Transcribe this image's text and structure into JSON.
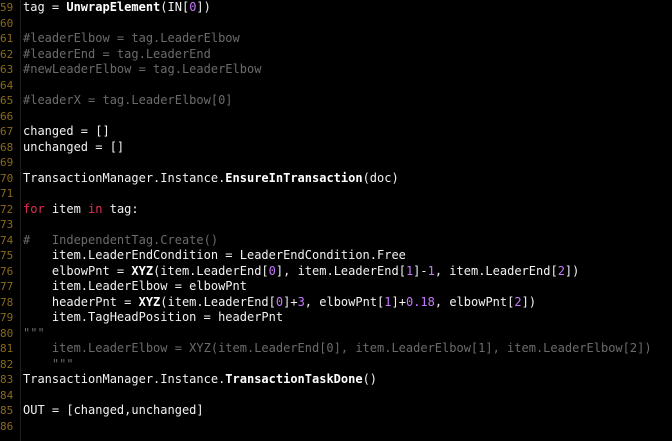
{
  "editor": {
    "colors": {
      "background": "#000000",
      "line_number": "#8a6a1a",
      "keyword": "#e02e55",
      "number": "#c678ff",
      "comment": "#6b6b6b",
      "text": "#f2f2f2"
    },
    "lines": [
      {
        "n": "59",
        "tokens": [
          [
            "plain",
            "tag = "
          ],
          [
            "fn",
            "UnwrapElement"
          ],
          [
            "plain",
            "(IN["
          ],
          [
            "num",
            "0"
          ],
          [
            "plain",
            "])"
          ]
        ]
      },
      {
        "n": "60",
        "tokens": []
      },
      {
        "n": "61",
        "tokens": [
          [
            "cmt",
            "#leaderElbow = tag.LeaderElbow"
          ]
        ]
      },
      {
        "n": "62",
        "tokens": [
          [
            "cmt",
            "#leaderEnd = tag.LeaderEnd"
          ]
        ]
      },
      {
        "n": "63",
        "tokens": [
          [
            "cmt",
            "#newLeaderElbow = tag.LeaderElbow"
          ]
        ]
      },
      {
        "n": "64",
        "tokens": []
      },
      {
        "n": "65",
        "tokens": [
          [
            "cmt",
            "#leaderX = tag.LeaderElbow[0]"
          ]
        ]
      },
      {
        "n": "66",
        "tokens": []
      },
      {
        "n": "67",
        "tokens": [
          [
            "plain",
            "changed = []"
          ]
        ]
      },
      {
        "n": "68",
        "tokens": [
          [
            "plain",
            "unchanged = []"
          ]
        ]
      },
      {
        "n": "69",
        "tokens": []
      },
      {
        "n": "70",
        "tokens": [
          [
            "plain",
            "TransactionManager.Instance."
          ],
          [
            "fn",
            "EnsureInTransaction"
          ],
          [
            "plain",
            "(doc)"
          ]
        ]
      },
      {
        "n": "71",
        "tokens": []
      },
      {
        "n": "72",
        "tokens": [
          [
            "kw",
            "for"
          ],
          [
            "plain",
            " item "
          ],
          [
            "kw",
            "in"
          ],
          [
            "plain",
            " tag:"
          ]
        ]
      },
      {
        "n": "73",
        "tokens": []
      },
      {
        "n": "74",
        "tokens": [
          [
            "cmt",
            "#   IndependentTag.Create()"
          ]
        ]
      },
      {
        "n": "75",
        "tokens": [
          [
            "plain",
            "    item.LeaderEndCondition = LeaderEndCondition.Free"
          ]
        ]
      },
      {
        "n": "76",
        "tokens": [
          [
            "plain",
            "    elbowPnt = "
          ],
          [
            "fn",
            "XYZ"
          ],
          [
            "plain",
            "(item.LeaderEnd["
          ],
          [
            "num",
            "0"
          ],
          [
            "plain",
            "], item.LeaderEnd["
          ],
          [
            "num",
            "1"
          ],
          [
            "plain",
            "]-"
          ],
          [
            "num",
            "1"
          ],
          [
            "plain",
            ", item.LeaderEnd["
          ],
          [
            "num",
            "2"
          ],
          [
            "plain",
            "])"
          ]
        ]
      },
      {
        "n": "77",
        "tokens": [
          [
            "plain",
            "    item.LeaderElbow = elbowPnt"
          ]
        ]
      },
      {
        "n": "78",
        "tokens": [
          [
            "plain",
            "    headerPnt = "
          ],
          [
            "fn",
            "XYZ"
          ],
          [
            "plain",
            "(item.LeaderEnd["
          ],
          [
            "num",
            "0"
          ],
          [
            "plain",
            "]+"
          ],
          [
            "num",
            "3"
          ],
          [
            "plain",
            ", elbowPnt["
          ],
          [
            "num",
            "1"
          ],
          [
            "plain",
            "]+"
          ],
          [
            "num",
            "0.18"
          ],
          [
            "plain",
            ", elbowPnt["
          ],
          [
            "num",
            "2"
          ],
          [
            "plain",
            "])"
          ]
        ]
      },
      {
        "n": "79",
        "tokens": [
          [
            "plain",
            "    item.TagHeadPosition = headerPnt"
          ]
        ]
      },
      {
        "n": "80",
        "tokens": [
          [
            "str",
            "\"\"\""
          ]
        ]
      },
      {
        "n": "81",
        "tokens": [
          [
            "str",
            "    item.LeaderElbow = XYZ(item.LeaderEnd[0], item.LeaderElbow[1], item.LeaderElbow[2])"
          ]
        ]
      },
      {
        "n": "82",
        "tokens": [
          [
            "str",
            "    \"\"\""
          ]
        ]
      },
      {
        "n": "83",
        "tokens": [
          [
            "plain",
            "TransactionManager.Instance."
          ],
          [
            "fn",
            "TransactionTaskDone"
          ],
          [
            "plain",
            "()"
          ]
        ]
      },
      {
        "n": "84",
        "tokens": []
      },
      {
        "n": "85",
        "tokens": [
          [
            "plain",
            "OUT = [changed,unchanged]"
          ]
        ]
      },
      {
        "n": "86",
        "tokens": []
      }
    ]
  }
}
